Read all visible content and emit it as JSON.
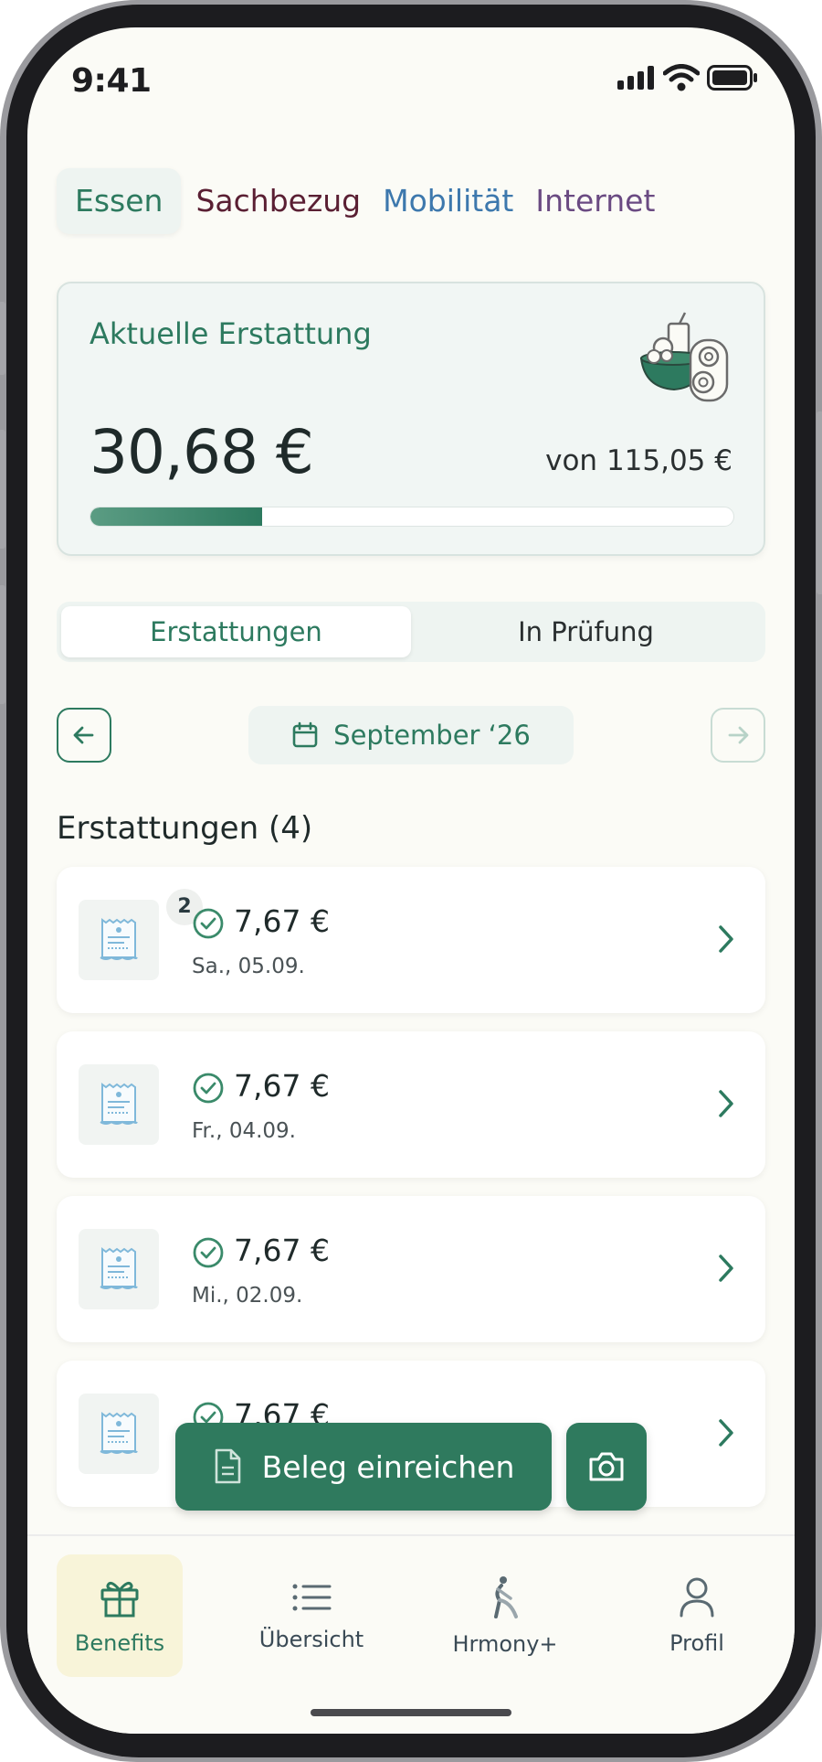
{
  "status_bar": {
    "time": "9:41"
  },
  "category_tabs": [
    {
      "label": "Essen",
      "active": true,
      "color": "#2d7a5f"
    },
    {
      "label": "Sachbezug",
      "active": false,
      "color": "#5a1f33"
    },
    {
      "label": "Mobilität",
      "active": false,
      "color": "#3d78ad"
    },
    {
      "label": "Internet",
      "active": false,
      "color": "#6a4a82"
    }
  ],
  "reimbursement_card": {
    "title": "Aktuelle Erstattung",
    "amount": "30,68 €",
    "of_total": "von 115,05 €",
    "progress": 0.267,
    "illustration_icon": "food-bowl-drink-icon"
  },
  "segmented_control": {
    "items": [
      {
        "label": "Erstattungen",
        "active": true
      },
      {
        "label": "In Prüfung",
        "active": false
      }
    ]
  },
  "month_selector": {
    "prev_icon": "arrow-left-icon",
    "label": "September ‘26",
    "calendar_icon": "calendar-icon",
    "next_icon": "arrow-right-icon"
  },
  "list": {
    "title": "Erstattungen (4)",
    "items": [
      {
        "amount": "7,67 €",
        "date": "Sa., 05.09.",
        "badge": "2",
        "status_icon": "check-circle-icon"
      },
      {
        "amount": "7,67 €",
        "date": "Fr., 04.09.",
        "badge": "",
        "status_icon": "check-circle-icon"
      },
      {
        "amount": "7,67 €",
        "date": "Mi., 02.09.",
        "badge": "",
        "status_icon": "check-circle-icon"
      },
      {
        "amount": "7,67 €",
        "date": "",
        "badge": "",
        "status_icon": "check-circle-icon"
      }
    ]
  },
  "actions": {
    "submit_label": "Beleg einreichen",
    "submit_icon": "document-icon",
    "camera_icon": "camera-icon"
  },
  "bottom_nav": [
    {
      "label": "Benefits",
      "icon": "gift-icon",
      "active": true
    },
    {
      "label": "Übersicht",
      "icon": "list-icon",
      "active": false
    },
    {
      "label": "Hrmony+",
      "icon": "hrmony-figure-icon",
      "active": false
    },
    {
      "label": "Profil",
      "icon": "user-icon",
      "active": false
    }
  ],
  "colors": {
    "brand_green": "#2d7a5f",
    "background": "#fbfbf6",
    "active_nav_bg": "#f8f4d9"
  }
}
